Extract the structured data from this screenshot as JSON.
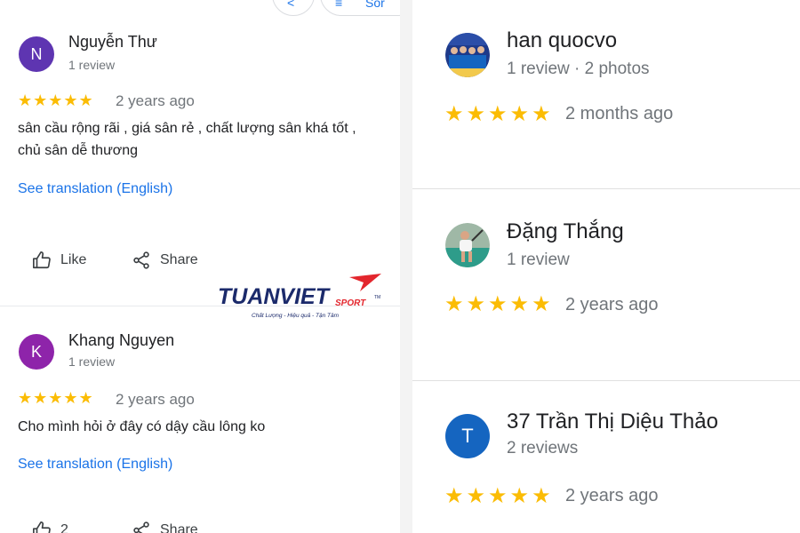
{
  "top_buttons": {
    "back_glyph": "<",
    "partial_label": "Sor"
  },
  "left_reviews": [
    {
      "initial": "N",
      "avatar_color": "#5e35b1",
      "name": "Nguyễn Thư",
      "meta": "1 review",
      "stars": "★★★★★",
      "rating": 5,
      "date": "2 years ago",
      "text": "sân cầu rộng rãi , giá sân rẻ , chất lượng sân khá tốt ,\nchủ sân dễ thương",
      "translation": "See translation (English)",
      "like_label": "Like",
      "share_label": "Share"
    },
    {
      "initial": "K",
      "avatar_color": "#8e24aa",
      "name": "Khang Nguyen",
      "meta": "1 review",
      "stars": "★★★★★",
      "rating": 5,
      "date": "2 years ago",
      "text": "Cho mình hỏi ở đây có dậy cầu lông ko",
      "translation": "See translation (English)",
      "like_label": "2",
      "share_label": "Share"
    }
  ],
  "logo": {
    "brand": "TUANVIET",
    "suffix": "SPORT",
    "tm": "TM",
    "tagline": "Chất Lượng - Hiệu quả - Tận Tâm",
    "brand_color": "#1b2a6b",
    "accent_color": "#e3262d"
  },
  "right_reviews": [
    {
      "avatar_kind": "photo-team",
      "name": "han quocvo",
      "meta": "1 review · 2 photos",
      "stars": "★★★★★",
      "rating": 5,
      "date": "2 months ago"
    },
    {
      "avatar_kind": "photo-badminton",
      "name": "Đặng Thắng",
      "meta": "1 review",
      "stars": "★★★★★",
      "rating": 5,
      "date": "2 years ago"
    },
    {
      "avatar_kind": "letter",
      "initial": "T",
      "avatar_color": "#1565c0",
      "name": "37 Trần Thị Diệu Thảo",
      "meta": "2 reviews",
      "stars": "★★★★★",
      "rating": 5,
      "date": "2 years ago"
    }
  ],
  "colors": {
    "star": "#fbbc04",
    "link": "#1a73e8"
  }
}
